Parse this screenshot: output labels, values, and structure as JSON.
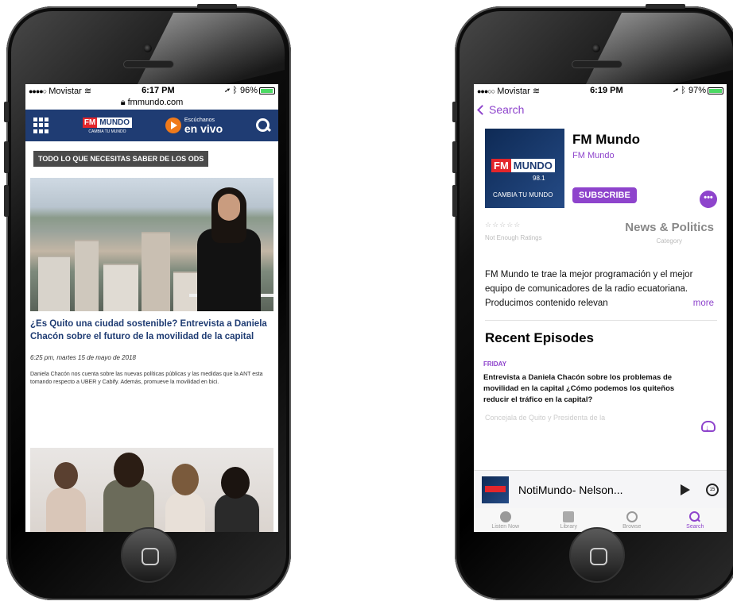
{
  "left_phone": {
    "status": {
      "carrier": "Movistar",
      "time": "6:17 PM",
      "battery": "96%",
      "battery_level": 0.96
    },
    "url": "fmmundo.com",
    "site": {
      "logo_fm": "FM",
      "logo_mundo": "MUNDO",
      "logo_tagline": "CAMBIA TU MUNDO",
      "live_small": "Escúchanos",
      "live_big": "en vivo"
    },
    "section_banner": "TODO LO QUE NECESITAS SABER DE LOS ODS",
    "article": {
      "title": "¿Es Quito una ciudad sostenible? Entrevista a Daniela Chacón sobre el futuro de la movilidad de la capital",
      "date": "6:25 pm, martes 15 de mayo de 2018",
      "excerpt": "Daniela Chacón nos cuenta sobre las nuevas políticas públicas y las medidas que la ANT esta tomando respecto a UBER y Cabify. Además, promueve la movilidad en bici."
    }
  },
  "right_phone": {
    "status": {
      "carrier": "Movistar",
      "time": "6:19 PM",
      "battery": "97%",
      "battery_level": 0.97
    },
    "back_label": "Search",
    "podcast": {
      "title": "FM Mundo",
      "author": "FM Mundo",
      "art_fm": "FM",
      "art_mundo": "MUNDO",
      "art_freq": "98.1",
      "art_tagline": "CAMBIA TU MUNDO",
      "subscribe_label": "SUBSCRIBE",
      "more_label": "•••",
      "stars": "☆☆☆☆☆",
      "rating_label": "Not Enough Ratings",
      "category": "News & Politics",
      "category_label": "Category",
      "description": "FM Mundo te trae la mejor programación y el mejor equipo de comunicadores de la radio ecuatoriana. Producimos contenido relevan",
      "description_more": "more"
    },
    "recent_heading": "Recent Episodes",
    "episode": {
      "day": "FRIDAY",
      "title": "Entrevista a Daniela Chacón sobre los problemas de movilidad en la capital ¿Cómo podemos los quiteños reducir el tráfico en la capital?",
      "faded": "Concejala de Quito y Presidenta de la"
    },
    "now_playing": "NotiMundo- Nelson...",
    "skip_label": "15",
    "tabs": [
      {
        "label": "Listen Now"
      },
      {
        "label": "Library"
      },
      {
        "label": "Browse"
      },
      {
        "label": "Search"
      }
    ]
  }
}
